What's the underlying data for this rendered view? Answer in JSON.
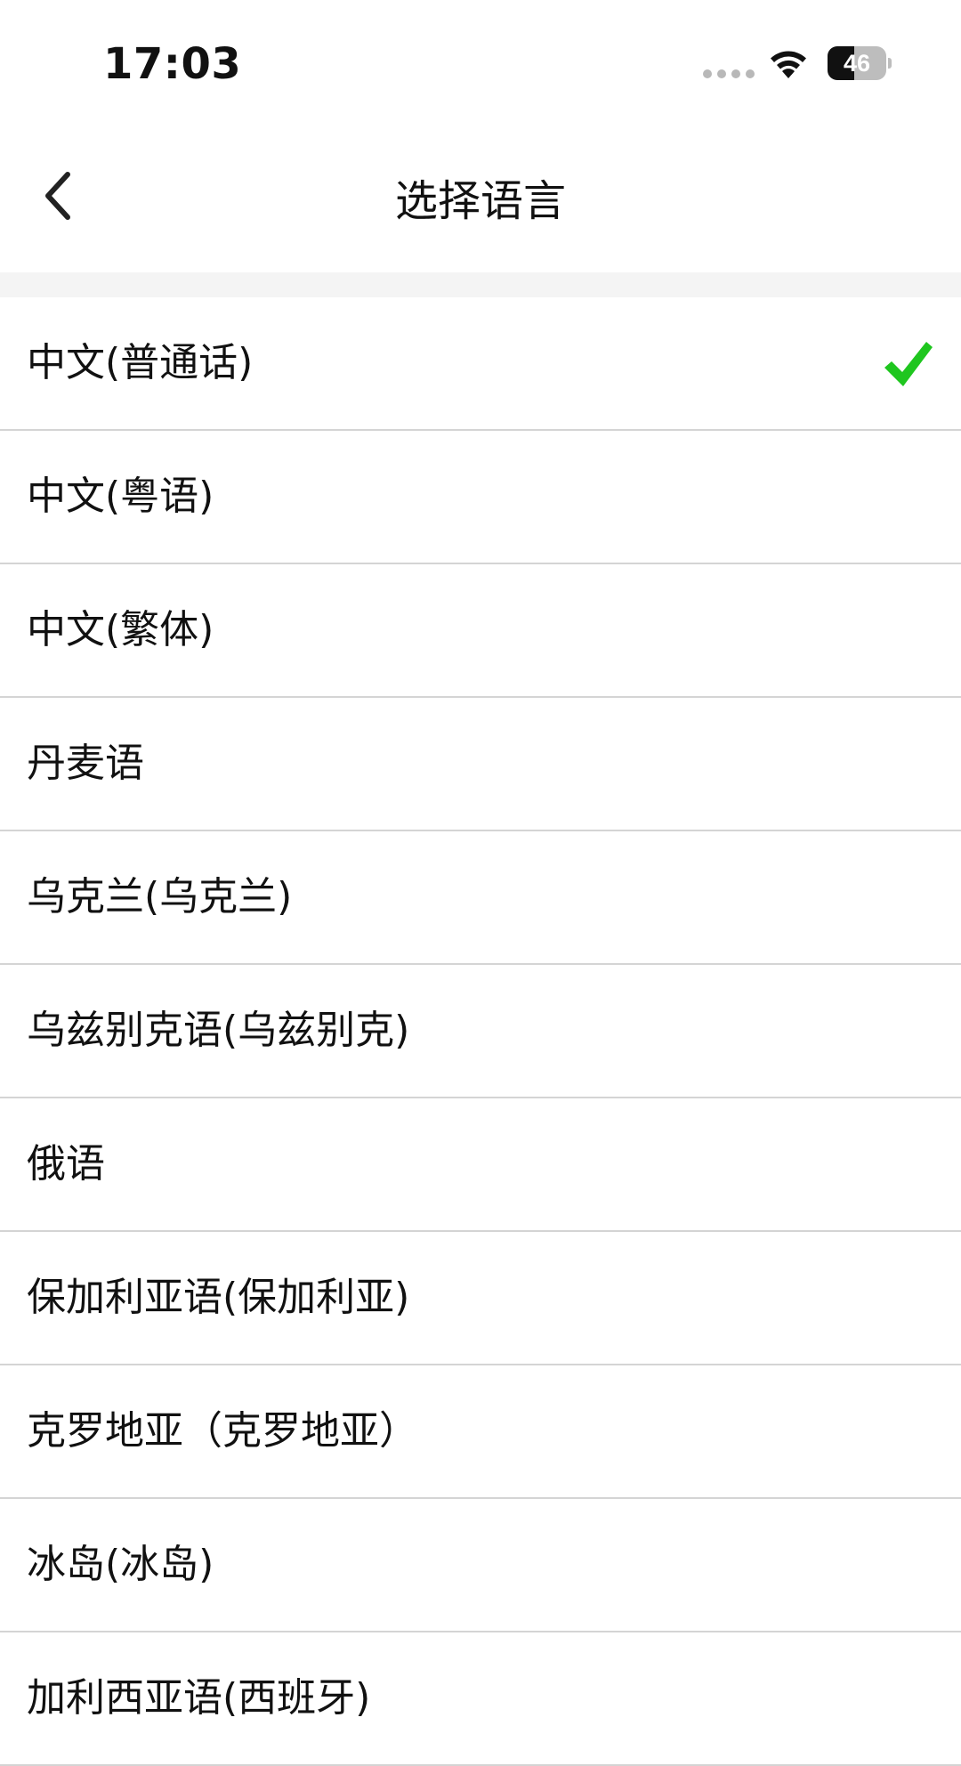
{
  "status_bar": {
    "time": "17:03",
    "battery": "46",
    "battery_level": 0.46,
    "icons": [
      "signal-dots-icon",
      "wifi-icon",
      "battery-icon"
    ]
  },
  "nav": {
    "title": "选择语言",
    "back_icon": "chevron-left-icon"
  },
  "colors": {
    "check": "#1fc61f",
    "separator": "#d4d4d4",
    "section_gap": "#f4f4f4"
  },
  "languages": [
    {
      "label": "中文(普通话)",
      "selected": true
    },
    {
      "label": "中文(粤语)",
      "selected": false
    },
    {
      "label": "中文(繁体)",
      "selected": false
    },
    {
      "label": "丹麦语",
      "selected": false
    },
    {
      "label": "乌克兰(乌克兰)",
      "selected": false
    },
    {
      "label": "乌兹别克语(乌兹别克)",
      "selected": false
    },
    {
      "label": "俄语",
      "selected": false
    },
    {
      "label": "保加利亚语(保加利亚)",
      "selected": false
    },
    {
      "label": "克罗地亚（克罗地亚）",
      "selected": false
    },
    {
      "label": "冰岛(冰岛)",
      "selected": false
    },
    {
      "label": "加利西亚语(西班牙)",
      "selected": false
    }
  ]
}
